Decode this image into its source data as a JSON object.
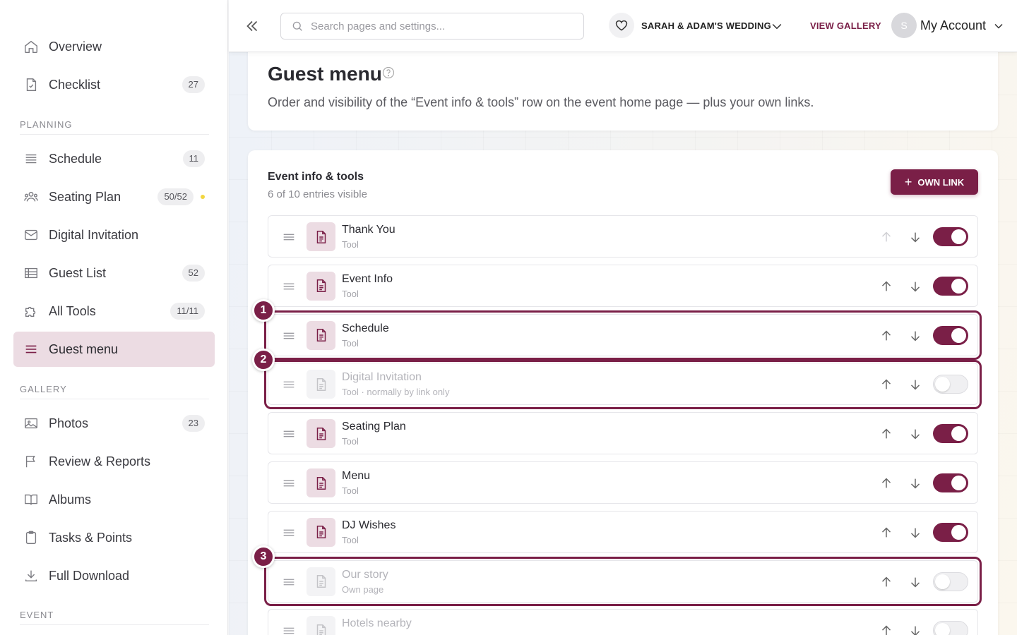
{
  "sidebar": {
    "items": [
      {
        "label": "Overview",
        "icon": "home-icon",
        "count": ""
      },
      {
        "label": "Checklist",
        "icon": "file-check-icon",
        "count": "27"
      },
      {
        "label": "Schedule",
        "icon": "list-icon",
        "count": "11"
      },
      {
        "label": "Seating Plan",
        "icon": "people-icon",
        "count": "50/52"
      },
      {
        "label": "Digital Invitation",
        "icon": "envelope-icon",
        "count": ""
      },
      {
        "label": "Guest List",
        "icon": "table-icon",
        "count": "52"
      },
      {
        "label": "All Tools",
        "icon": "puzzle-icon",
        "count": "11/11"
      },
      {
        "label": "Guest menu",
        "icon": "menu-icon",
        "count": ""
      },
      {
        "label": "Photos",
        "icon": "image-icon",
        "count": "23"
      },
      {
        "label": "Review & Reports",
        "icon": "flag-icon",
        "count": ""
      },
      {
        "label": "Albums",
        "icon": "book-icon",
        "count": ""
      },
      {
        "label": "Tasks & Points",
        "icon": "clipboard-icon",
        "count": ""
      },
      {
        "label": "Full Download",
        "icon": "download-icon",
        "count": ""
      }
    ],
    "sections": {
      "planning": "PLANNING",
      "gallery": "GALLERY",
      "event": "EVENT"
    },
    "active": "Guest menu",
    "accent_dot_color": "#f2d640"
  },
  "topbar": {
    "search_placeholder": "Search pages and settings...",
    "event_name": "SARAH & ADAM'S WEDDING",
    "view_gallery": "VIEW GALLERY",
    "avatar_initial": "S",
    "account_label": "My Account"
  },
  "header": {
    "title": "Guest menu",
    "description": "Order and visibility of the “Event info & tools” row on the event home page — plus your own links."
  },
  "tools_card": {
    "title": "Event info & tools",
    "subtitle": "6 of 10 entries visible",
    "add_button": "OWN LINK",
    "rows": [
      {
        "name": "Thank You",
        "type": "Tool",
        "enabled": true
      },
      {
        "name": "Event Info",
        "type": "Tool",
        "enabled": true
      },
      {
        "name": "Schedule",
        "type": "Tool",
        "enabled": true
      },
      {
        "name": "Digital Invitation",
        "type": "Tool · normally by link only",
        "enabled": false
      },
      {
        "name": "Seating Plan",
        "type": "Tool",
        "enabled": true
      },
      {
        "name": "Menu",
        "type": "Tool",
        "enabled": true
      },
      {
        "name": "DJ Wishes",
        "type": "Tool",
        "enabled": true
      },
      {
        "name": "Our story",
        "type": "Own page",
        "enabled": false
      },
      {
        "name": "Hotels nearby",
        "type": "",
        "enabled": false
      }
    ]
  },
  "annotations": [
    "1",
    "2",
    "3"
  ],
  "colors": {
    "accent": "#7a1f47",
    "accent_light": "#ecdce3"
  }
}
